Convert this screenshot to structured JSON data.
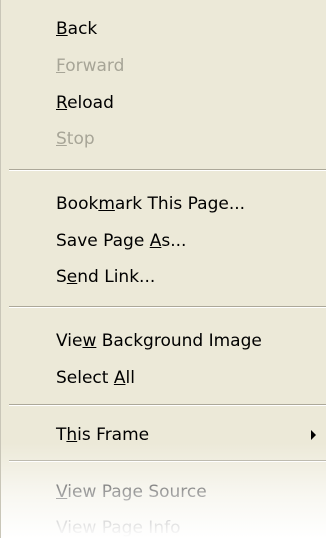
{
  "menu": {
    "items": [
      {
        "pre": "",
        "acc": "B",
        "post": "ack",
        "enabled": true
      },
      {
        "pre": "",
        "acc": "F",
        "post": "orward",
        "enabled": false
      },
      {
        "pre": "",
        "acc": "R",
        "post": "eload",
        "enabled": true
      },
      {
        "pre": "",
        "acc": "S",
        "post": "top",
        "enabled": false
      },
      {
        "pre": "Book",
        "acc": "m",
        "post": "ark This Page...",
        "enabled": true
      },
      {
        "pre": "Save Page ",
        "acc": "A",
        "post": "s...",
        "enabled": true
      },
      {
        "pre": "S",
        "acc": "e",
        "post": "nd Link...",
        "enabled": true
      },
      {
        "pre": "Vie",
        "acc": "w",
        "post": " Background Image",
        "enabled": true
      },
      {
        "pre": "Select ",
        "acc": "A",
        "post": "ll",
        "enabled": true
      },
      {
        "pre": "T",
        "acc": "h",
        "post": "is Frame",
        "enabled": true,
        "submenu": true
      },
      {
        "pre": "",
        "acc": "V",
        "post": "iew Page Source",
        "enabled": true
      },
      {
        "pre": "View Page Info",
        "acc": "",
        "post": "",
        "enabled": true
      }
    ]
  },
  "colors": {
    "menu_background": "#ece9d8",
    "text": "#000000",
    "disabled_text": "#a7a597",
    "separator": "#aca899"
  }
}
